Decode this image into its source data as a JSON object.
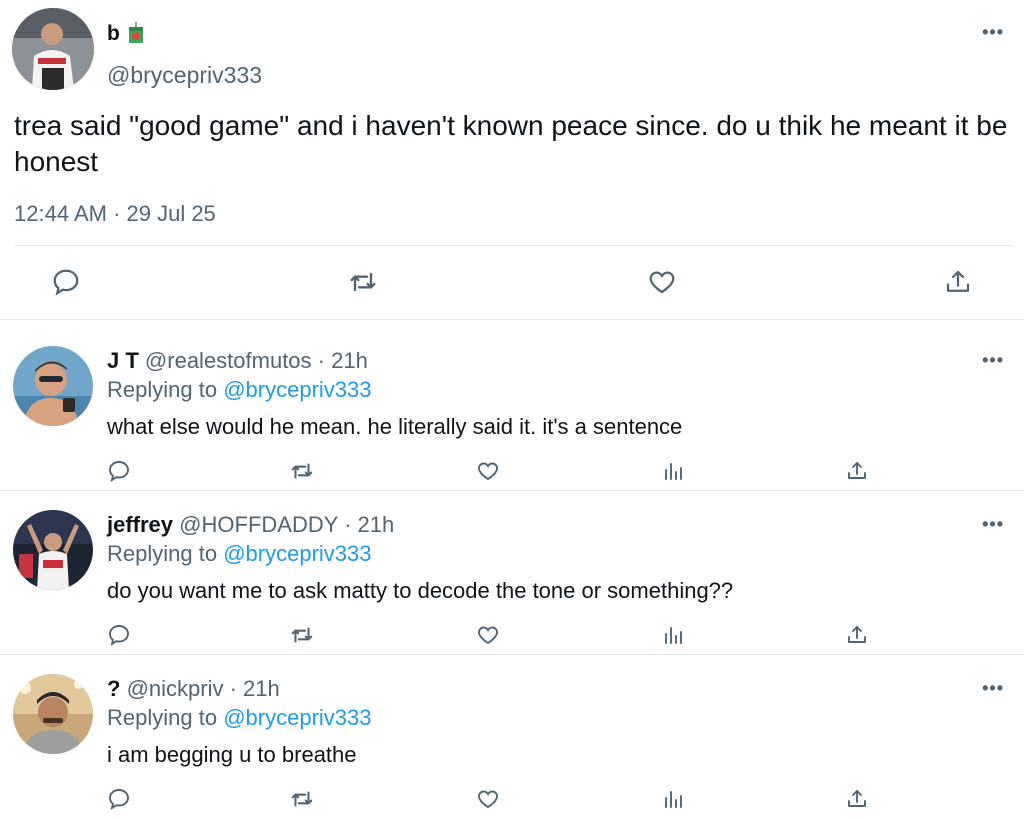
{
  "main_tweet": {
    "display_name": "b",
    "handle": "@brycepriv333",
    "text": "trea said \"good game\" and i haven't known peace since. do u thik he meant it be honest",
    "timestamp": "12:44 AM · 29 Jul 25",
    "more_label": "•••",
    "actions": [
      "reply-icon",
      "retweet-icon",
      "like-icon",
      "share-icon"
    ]
  },
  "replies": [
    {
      "display_name": "J T",
      "handle_time": "@realestofmutos · 21h",
      "replying_prefix": "Replying to",
      "replying_handle": "@brycepriv333",
      "text": "what else would he mean. he literally said it. it's a sentence",
      "more_label": "•••"
    },
    {
      "display_name": "jeffrey",
      "handle_time": "@HOFFDADDY · 21h",
      "replying_prefix": "Replying to",
      "replying_handle": "@brycepriv333",
      "text": "do you want me to ask matty to decode the tone or something??",
      "more_label": "•••"
    },
    {
      "display_name": "?",
      "handle_time": "@nickpriv · 21h",
      "replying_prefix": "Replying to",
      "replying_handle": "@brycepriv333",
      "text": "i am begging u to breathe",
      "more_label": "•••"
    }
  ],
  "reply_actions": [
    "reply-icon",
    "retweet-icon",
    "like-icon",
    "analytics-icon",
    "share-icon"
  ],
  "colors": {
    "text": "#0f1419",
    "secondary": "#536471",
    "link": "#1d9bf0",
    "divider": "#e6e9ec"
  }
}
